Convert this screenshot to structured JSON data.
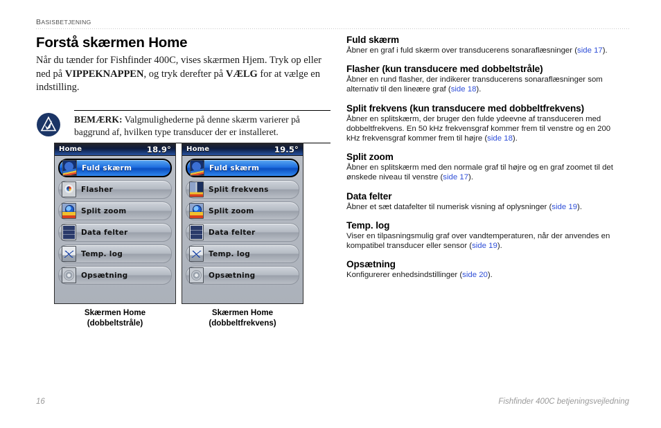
{
  "header": {
    "running_head_first": "B",
    "running_head_rest": "ASISBETJENING"
  },
  "left_column": {
    "title": "Forstå skærmen Home",
    "intro_part1": "Når du tænder for Fishfinder 400C, vises skærmen Hjem. Tryk op eller ned på ",
    "intro_bold1": "VIPPEKNAPPEN",
    "intro_part2": ", og tryk derefter på ",
    "intro_bold2": "VÆLG",
    "intro_part3": " for at vælge en indstilling.",
    "note_label": "BEMÆRK:",
    "note_text": " Valgmulighederne på denne skærm varierer på baggrund af, hvilken type transducer der er installeret.",
    "note_icon": "garmin-triangle-check-icon"
  },
  "devices": [
    {
      "name": "dual-beam-home-screen",
      "title": "Home",
      "temperature": "18.9°",
      "caption_line1": "Skærmen Home",
      "caption_line2": "(dobbeltstråle)",
      "items": [
        {
          "label": "Fuld skærm",
          "icon": "full-screen-sonar-icon",
          "icon_class": "ic-full",
          "selected": true
        },
        {
          "label": "Flasher",
          "icon": "flasher-dial-icon",
          "icon_class": "ic-flash",
          "selected": false
        },
        {
          "label": "Split zoom",
          "icon": "split-zoom-icon",
          "icon_class": "ic-splitz",
          "selected": false
        },
        {
          "label": "Data felter",
          "icon": "data-fields-icon",
          "icon_class": "ic-data",
          "selected": false
        },
        {
          "label": "Temp. log",
          "icon": "temperature-log-icon",
          "icon_class": "ic-temp",
          "selected": false
        },
        {
          "label": "Opsætning",
          "icon": "settings-gear-icon",
          "icon_class": "ic-setup",
          "selected": false
        }
      ]
    },
    {
      "name": "dual-frequency-home-screen",
      "title": "Home",
      "temperature": "19.5°",
      "caption_line1": "Skærmen Home",
      "caption_line2": "(dobbeltfrekvens)",
      "items": [
        {
          "label": "Fuld skærm",
          "icon": "full-screen-sonar-icon",
          "icon_class": "ic-full",
          "selected": true
        },
        {
          "label": "Split frekvens",
          "icon": "split-frequency-icon",
          "icon_class": "ic-splitf",
          "selected": false
        },
        {
          "label": "Split zoom",
          "icon": "split-zoom-icon",
          "icon_class": "ic-splitz",
          "selected": false
        },
        {
          "label": "Data felter",
          "icon": "data-fields-icon",
          "icon_class": "ic-data",
          "selected": false
        },
        {
          "label": "Temp. log",
          "icon": "temperature-log-icon",
          "icon_class": "ic-temp",
          "selected": false
        },
        {
          "label": "Opsætning",
          "icon": "settings-gear-icon",
          "icon_class": "ic-setup",
          "selected": false
        }
      ]
    }
  ],
  "right_column": {
    "entries": [
      {
        "heading": "Fuld skærm",
        "text_before": "Åbner en graf i fuld skærm over transducerens sonaraflæsninger (",
        "xref": "side 17",
        "text_after": ")."
      },
      {
        "heading": "Flasher (kun transducere med dobbeltstråle)",
        "text_before": "Åbner en rund flasher, der indikerer transducerens sonaraflæsninger som alternativ til den lineære graf (",
        "xref": "side 18",
        "text_after": ")."
      },
      {
        "heading": "Split frekvens (kun transducere med dobbeltfrekvens)",
        "text_before": "Åbner en splitskærm, der bruger den fulde ydeevne af transduceren med dobbeltfrekvens. En 50 kHz frekvensgraf kommer frem til venstre og en 200 kHz frekvensgraf kommer frem til højre (",
        "xref": "side 18",
        "text_after": ")."
      },
      {
        "heading": "Split zoom",
        "text_before": "Åbner en splitskærm med den normale graf til højre og en graf zoomet til det ønskede niveau til venstre (",
        "xref": "side 17",
        "text_after": ")."
      },
      {
        "heading": "Data felter",
        "text_before": "Åbner et sæt datafelter til numerisk visning af oplysninger (",
        "xref": "side 19",
        "text_after": ")."
      },
      {
        "heading": "Temp. log",
        "text_before": "Viser en tilpasningsmulig graf over vandtemperaturen, når der anvendes en kompatibel transducer eller sensor (",
        "xref": "side 19",
        "text_after": ")."
      },
      {
        "heading": "Opsætning",
        "text_before": "Konfigurerer enhedsindstillinger (",
        "xref": "side 20",
        "text_after": ")."
      }
    ]
  },
  "footer": {
    "page_number": "16",
    "doc_title": "Fishfinder 400C betjeningsvejledning"
  },
  "colors": {
    "xref_link": "#2f4fd8",
    "footer_gray": "#9a9a9a",
    "selected_blue": "#1f6fe0",
    "note_navy": "#1b3566"
  }
}
